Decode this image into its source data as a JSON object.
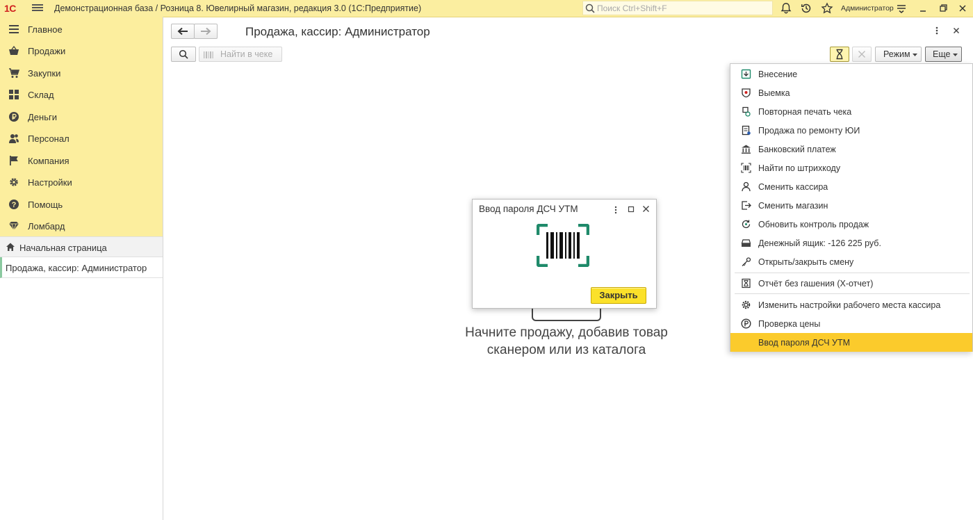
{
  "app": {
    "logo": "1С",
    "title": "Демонстрационная база / Розница 8. Ювелирный магазин, редакция 3.0  (1С:Предприятие)",
    "search_placeholder": "Поиск Ctrl+Shift+F",
    "user": "Администратор"
  },
  "sidebar": {
    "items": [
      {
        "label": "Главное",
        "icon": "menu-lines-icon"
      },
      {
        "label": "Продажи",
        "icon": "basket-icon"
      },
      {
        "label": "Закупки",
        "icon": "cart-icon"
      },
      {
        "label": "Склад",
        "icon": "warehouse-grid-icon"
      },
      {
        "label": "Деньги",
        "icon": "ruble-coin-icon"
      },
      {
        "label": "Персонал",
        "icon": "people-icon"
      },
      {
        "label": "Компания",
        "icon": "flag-icon"
      },
      {
        "label": "Настройки",
        "icon": "gear-icon"
      },
      {
        "label": "Помощь",
        "icon": "help-icon"
      },
      {
        "label": "Ломбард",
        "icon": "diamond-icon"
      }
    ],
    "home": "Начальная страница",
    "open_tab": "Продажа, кассир: Администратор"
  },
  "form": {
    "title": "Продажа, кассир: Администратор",
    "find_in_check": "Найти в чеке",
    "mode_button": "Режим",
    "more_button": "Еще",
    "hint": "Начните продажу, добавив товар сканером или из каталога"
  },
  "dialog": {
    "title": "Ввод пароля ДСЧ УТМ",
    "close_button": "Закрыть"
  },
  "menu": {
    "items": [
      {
        "label": "Внесение",
        "icon": "deposit-icon"
      },
      {
        "label": "Выемка",
        "icon": "withdrawal-icon"
      },
      {
        "label": "Повторная печать чека",
        "icon": "receipt-reprint-icon"
      },
      {
        "label": "Продажа по ремонту ЮИ",
        "icon": "repair-sale-icon"
      },
      {
        "label": "Банковский платеж",
        "icon": "bank-icon"
      },
      {
        "label": "Найти по штрихкоду",
        "icon": "barcode-icon"
      },
      {
        "label": "Сменить кассира",
        "icon": "person-icon"
      },
      {
        "label": "Сменить магазин",
        "icon": "exit-arrow-icon"
      },
      {
        "label": "Обновить контроль продаж",
        "icon": "refresh-icon"
      },
      {
        "label": "Денежный ящик: -126 225 руб.",
        "icon": "cash-drawer-icon"
      },
      {
        "label": "Открыть/закрыть смену",
        "icon": "key-icon"
      },
      {
        "label": "Отчёт без гашения (X-отчет)",
        "icon": "hourglass-report-icon"
      },
      {
        "label": "Изменить настройки рабочего места кассира",
        "icon": "gear-icon"
      },
      {
        "label": "Проверка цены",
        "icon": "price-check-icon"
      },
      {
        "label": "Ввод пароля ДСЧ УТМ",
        "icon": "password-icon"
      }
    ]
  },
  "colors": {
    "topbar": "#fbeea0",
    "sidebar": "#fcee9e",
    "selected": "#fbcb2c",
    "accent_green": "#1f8a6a",
    "logo_red": "#d0201e"
  }
}
